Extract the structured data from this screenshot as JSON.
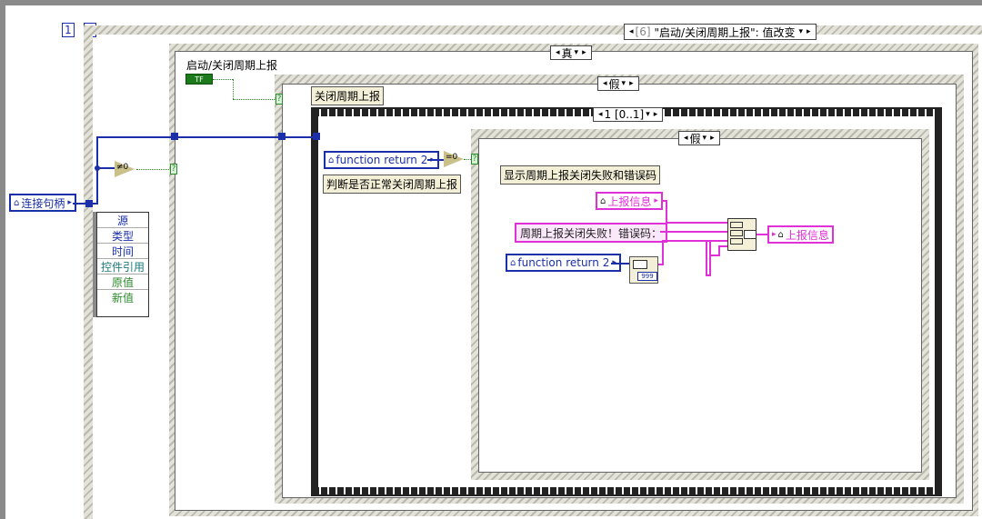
{
  "sequence": {
    "frame_number": "1",
    "close_glyph": "⊠"
  },
  "event_structure": {
    "selector_prev": "◂",
    "selector_index": "[6]",
    "selector_label": "\"启动/关闭周期上报\": 值改变",
    "selector_next": "▸"
  },
  "outer_case": {
    "selector_label": "真",
    "label": "启动/关闭周期上报"
  },
  "bool_control": {
    "label": "TF"
  },
  "inner_case": {
    "selector_label": "假",
    "label": "关闭周期上报"
  },
  "seq_frame": {
    "selector_label": "1 [0..1]"
  },
  "inner_case2": {
    "selector_label": "假"
  },
  "connection_handle": {
    "label": "连接句柄"
  },
  "not_equal_zero": {
    "label": "≠0"
  },
  "unbundle_event": {
    "items": [
      "源",
      "类型",
      "时间",
      "控件引用",
      "原值",
      "新值"
    ]
  },
  "function_return_1": {
    "label": "function return 2"
  },
  "equal_zero": {
    "label": "=0"
  },
  "comment_check": {
    "text": "判断是否正常关闭周期上报"
  },
  "comment_show": {
    "text": "显示周期上报关闭失败和错误码"
  },
  "report_info_in": {
    "label": "上报信息"
  },
  "error_string_const": {
    "text": "周期上报关闭失败！错误码："
  },
  "function_return_2": {
    "label": "function return 2"
  },
  "report_info_out": {
    "label": "上报信息"
  },
  "colors": {
    "int_wire": "#1a2fa8",
    "string_wire": "#e030d8",
    "bool_wire": "#2a8a2a"
  }
}
